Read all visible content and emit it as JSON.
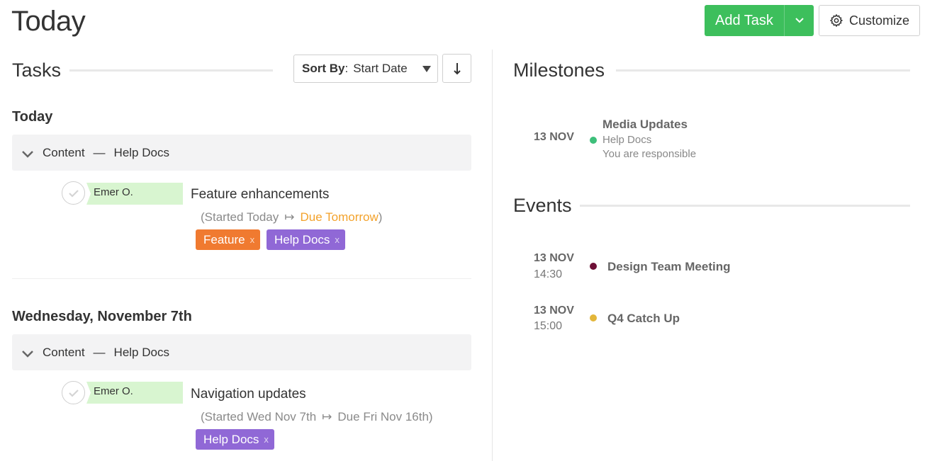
{
  "page_title": "Today",
  "header": {
    "add_task_label": "Add Task",
    "customize_label": "Customize",
    "accent_color": "#3dbf5c"
  },
  "tasks_panel": {
    "title": "Tasks",
    "sort_label": "Sort By",
    "sort_value": "Start Date",
    "sort_direction_icon": "arrow-down-icon",
    "groups": [
      {
        "day": "Today",
        "project": "Content",
        "subproject": "Help Docs",
        "task": {
          "assignee": "Emer O.",
          "name": "Feature enhancements",
          "meta_open": "(Started Today",
          "meta_arrow": "↦",
          "meta_due": "Due Tomorrow",
          "meta_close": ")",
          "tags": [
            {
              "label": "Feature",
              "remove": "x",
              "color": "#f07a30"
            },
            {
              "label": "Help Docs",
              "remove": "x",
              "color": "#9068d6"
            }
          ]
        }
      },
      {
        "day": "Wednesday, November 7th",
        "project": "Content",
        "subproject": "Help Docs",
        "task": {
          "assignee": "Emer O.",
          "name": "Navigation updates",
          "meta_open": "(Started Wed Nov 7th",
          "meta_arrow": "↦",
          "meta_due": "Due Fri Nov 16th",
          "meta_close": ")",
          "tags": [
            {
              "label": "Help Docs",
              "remove": "x",
              "color": "#9068d6"
            }
          ]
        }
      }
    ]
  },
  "milestones_panel": {
    "title": "Milestones",
    "items": [
      {
        "date": "13 NOV",
        "title": "Media Updates",
        "project": "Help Docs",
        "note": "You are responsible",
        "dot_color": "#3dbf7a"
      }
    ]
  },
  "events_panel": {
    "title": "Events",
    "items": [
      {
        "date": "13 NOV",
        "time": "14:30",
        "title": "Design Team Meeting",
        "dot_color": "#6e0f36"
      },
      {
        "date": "13 NOV",
        "time": "15:00",
        "title": "Q4 Catch Up",
        "dot_color": "#e3b63a"
      }
    ]
  }
}
